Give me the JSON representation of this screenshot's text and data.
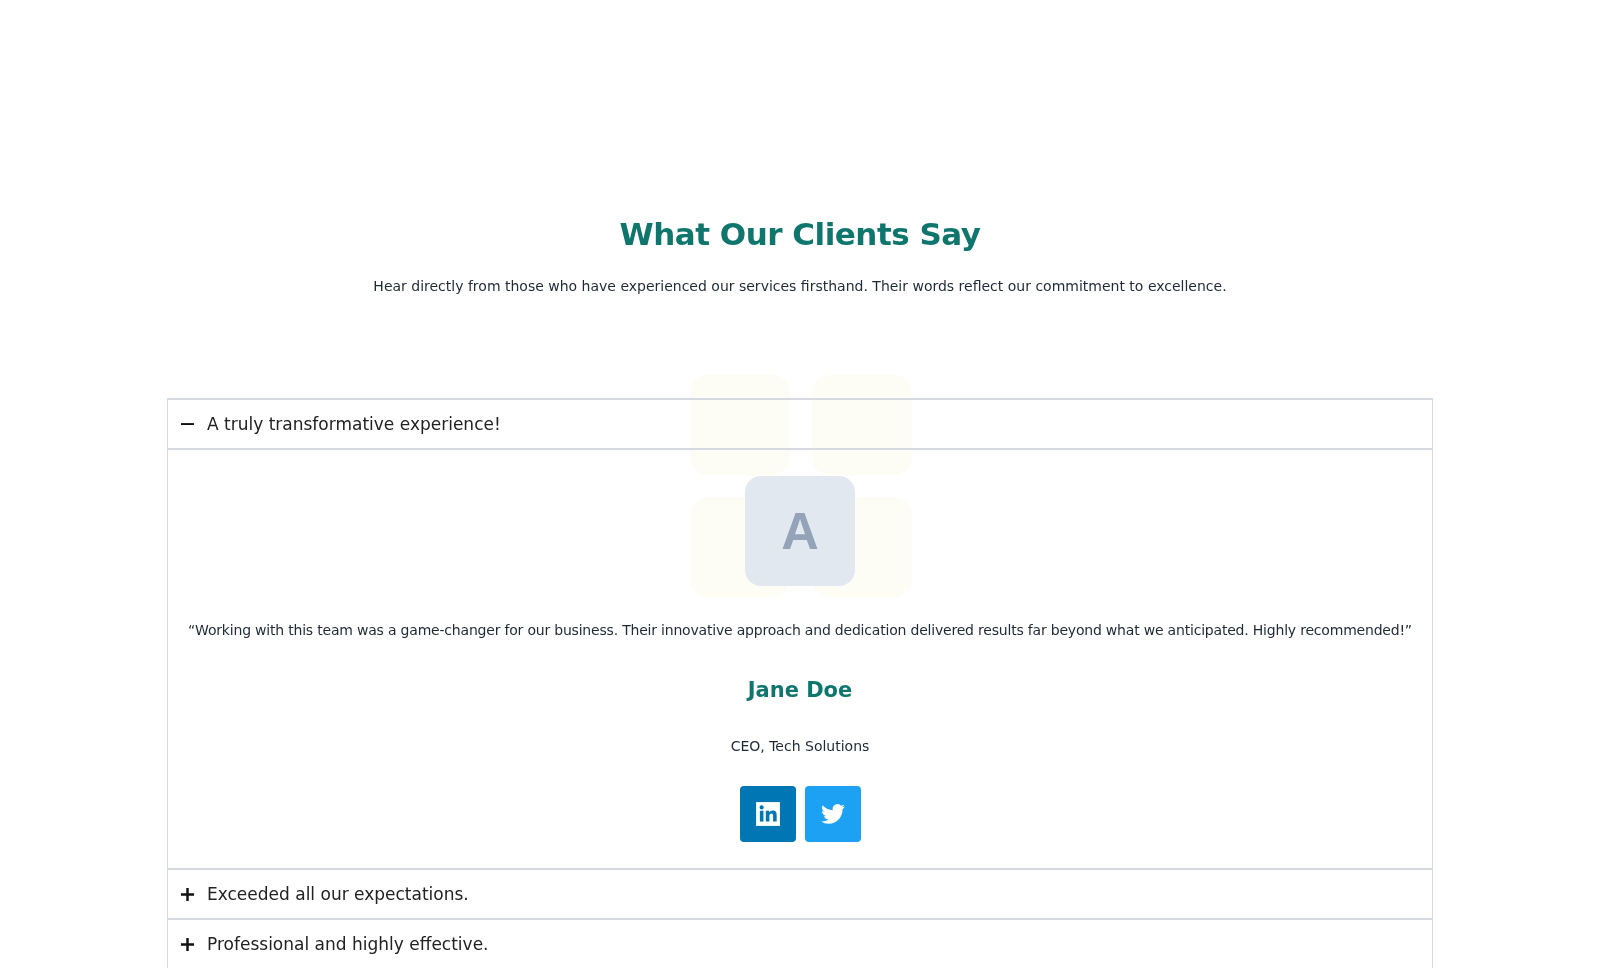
{
  "heading": "What Our Clients Say",
  "intro": "Hear directly from those who have experienced our services firsthand. Their words reflect our commitment to excellence.",
  "testimonials": [
    {
      "title": "A truly transformative experience!",
      "expanded": true,
      "initial": "A",
      "quote": "“Working with this team was a game-changer for our business. Their innovative approach and dedication delivered results far beyond what we anticipated. Highly recommended!”",
      "name": "Jane Doe",
      "role": "CEO, Tech Solutions",
      "socials": [
        {
          "kind": "linkedin"
        },
        {
          "kind": "twitter"
        }
      ]
    },
    {
      "title": "Exceeded all our expectations.",
      "expanded": false
    },
    {
      "title": "Professional and highly effective.",
      "expanded": false
    }
  ]
}
